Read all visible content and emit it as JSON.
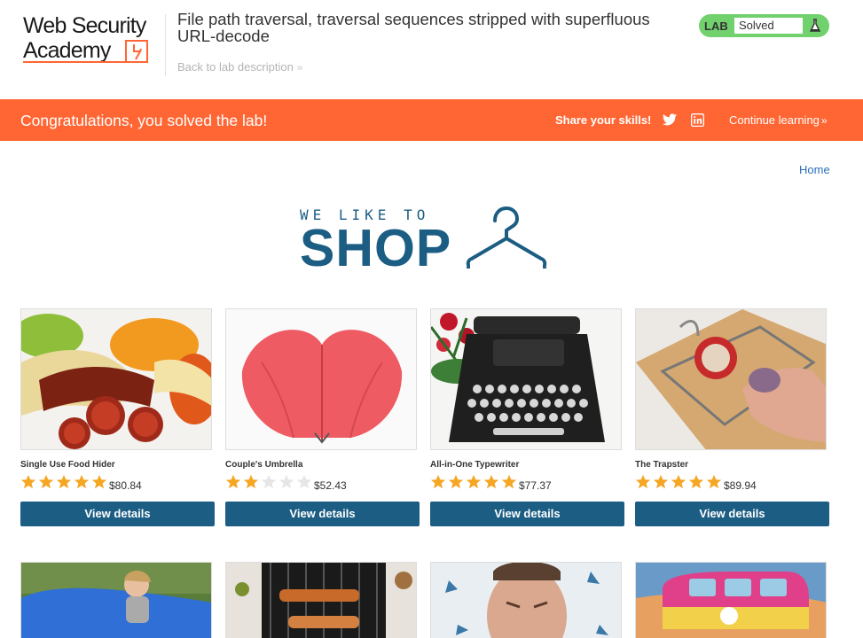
{
  "logo": {
    "line1": "Web Security",
    "line2": "Academy"
  },
  "header": {
    "lab_title": "File path traversal, traversal sequences stripped with superfluous URL-decode",
    "back_link": "Back to lab description",
    "lab_tag": "LAB",
    "status": "Solved"
  },
  "banner": {
    "message": "Congratulations, you solved the lab!",
    "share_label": "Share your skills!",
    "continue_label": "Continue learning"
  },
  "nav": {
    "home": "Home"
  },
  "hero": {
    "top_text": "WE LIKE TO",
    "main_text": "SHOP"
  },
  "colors": {
    "accent": "#ff6633",
    "primary": "#1c5d83",
    "solved": "#70d16d",
    "star": "#f5a623"
  },
  "products": [
    {
      "name": "Single Use Food Hider",
      "price": "$80.84",
      "rating": 5,
      "button": "View details",
      "image": "food-photo"
    },
    {
      "name": "Couple's Umbrella",
      "price": "$52.43",
      "rating": 2,
      "button": "View details",
      "image": "umbrella-photo"
    },
    {
      "name": "All-in-One Typewriter",
      "price": "$77.37",
      "rating": 5,
      "button": "View details",
      "image": "typewriter-photo"
    },
    {
      "name": "The Trapster",
      "price": "$89.94",
      "rating": 5,
      "button": "View details",
      "image": "mousetrap-photo"
    }
  ],
  "products_row2": [
    {
      "image": "beanbag-photo"
    },
    {
      "image": "grill-photo"
    },
    {
      "image": "sneeze-photo"
    },
    {
      "image": "monster-van-photo"
    }
  ]
}
